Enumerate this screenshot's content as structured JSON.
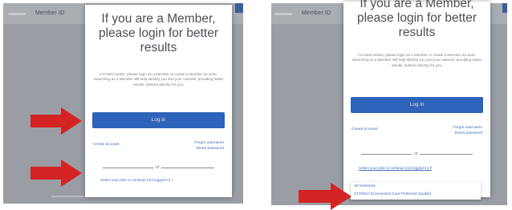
{
  "left_panel": {
    "header_tab": "Member ID",
    "modal": {
      "title": "If you are a Member, please login for better results",
      "description": "For best results, please login as a Member or create a Member account. Searching as a Member will help identify you and your network, providing faster results, tailored directly for you.",
      "login_label": "Log in",
      "create_account": "Create account",
      "forgot_username": "Forgot username",
      "reset_password": "Reset password",
      "or_label": "or",
      "select_plan": "Select your plan to continue (not logged in) >"
    }
  },
  "right_panel": {
    "header_tab": "Member ID",
    "modal": {
      "title": "If you are a Member, please login for better results",
      "description": "For best results, please login as a Member or create a Member account. Searching as a Member will help identify you and your network, providing faster results, tailored directly for you.",
      "login_label": "Log in",
      "create_account": "Create account",
      "forgot_username": "Forgot username",
      "reset_password": "Reset password",
      "or_label": "or",
      "select_plan": "Select your plan to continue (not logged in) ▾",
      "plan_options": [
        "All Networks",
        "STORSA (Connected Care Preferred Quality)"
      ]
    }
  },
  "colors": {
    "arrow": "#d42323",
    "login_button": "#2d63b8",
    "link": "#3f6fbf"
  }
}
